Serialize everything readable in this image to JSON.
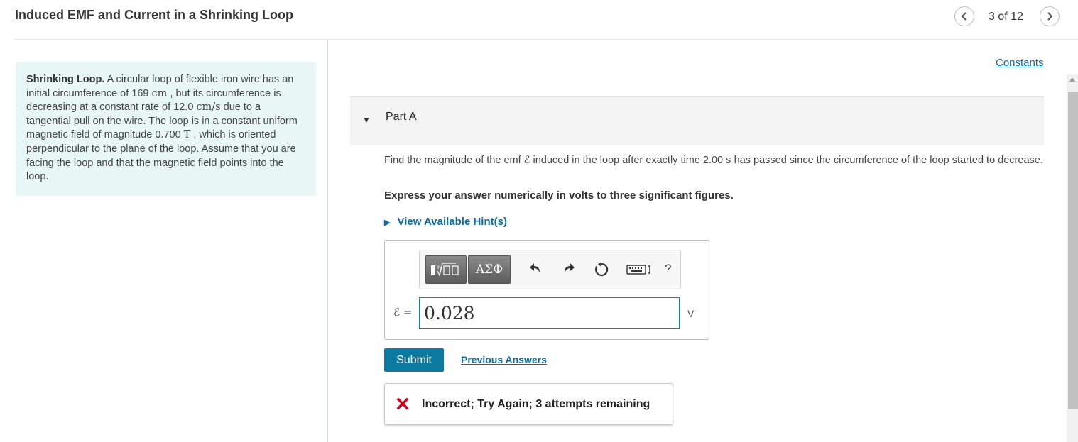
{
  "header": {
    "title": "Induced EMF and Current in a Shrinking Loop",
    "page_count": "3 of 12",
    "prev_icon": "chevron-left-icon",
    "next_icon": "chevron-right-icon"
  },
  "intro": {
    "lead": "Shrinking Loop.",
    "t1": " A circular loop of flexible iron wire has an initial circumference of 169 ",
    "u1": "cm",
    "t2": " , but its circumference is decreasing at a constant rate of 12.0 ",
    "u2": "cm/s",
    "t3": " due to a tangential pull on the wire. The loop is in a constant uniform magnetic field of magnitude 0.700 ",
    "u3": "T",
    "t4": " , which is oriented perpendicular to the plane of the loop. Assume that you are facing the loop and that the magnetic field points into the loop."
  },
  "constants_link": "Constants",
  "part": {
    "title": "Part A",
    "question_a": "Find the magnitude of the emf ",
    "question_symbol": "ℰ",
    "question_b": " induced in the loop after exactly time 2.00 ",
    "question_unit": "s",
    "question_c": " has passed since the circumference of the loop started to decrease.",
    "instruction": "Express your answer numerically in volts to three significant figures.",
    "hint_link": "View Available Hint(s)"
  },
  "answer": {
    "toolbar": {
      "template_icon": "templates-icon",
      "greek_label": "ΑΣΦ",
      "undo_icon": "undo-icon",
      "redo_icon": "redo-icon",
      "reset_icon": "reset-icon",
      "keyboard_icon": "keyboard-icon",
      "help_label": "?"
    },
    "variable_label": "ℰ =",
    "value": "0.028",
    "unit": "V"
  },
  "actions": {
    "submit_label": "Submit",
    "previous_answers_label": "Previous Answers"
  },
  "feedback": {
    "icon": "x-mark-icon",
    "text": "Incorrect; Try Again; 3 attempts remaining",
    "color": "#d0021b"
  }
}
